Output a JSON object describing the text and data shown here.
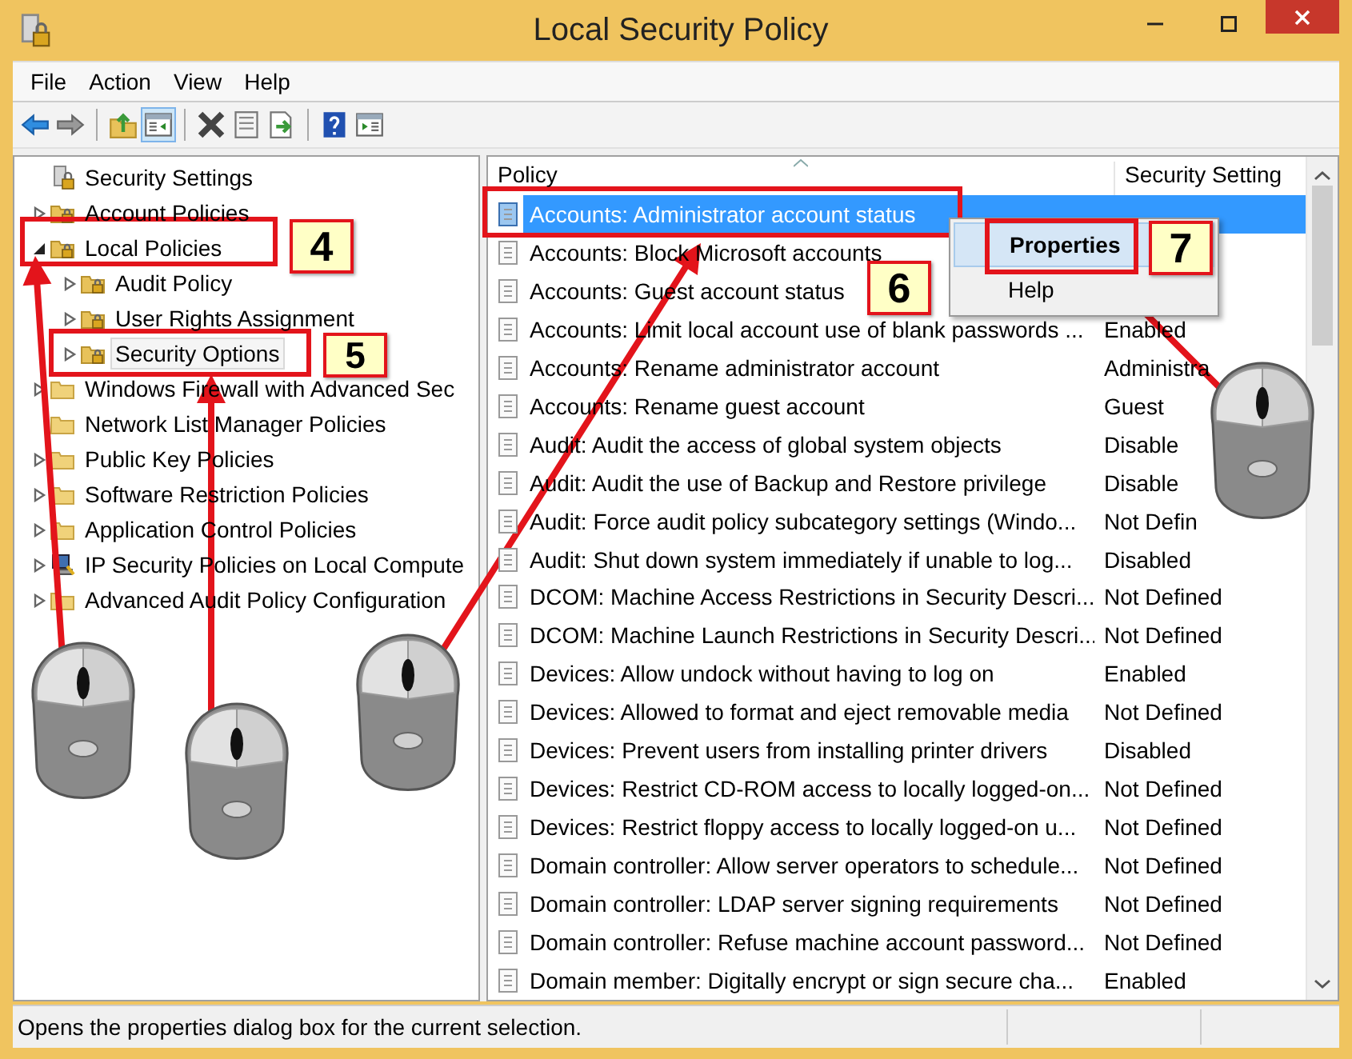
{
  "window": {
    "title": "Local Security Policy"
  },
  "menu": [
    "File",
    "Action",
    "View",
    "Help"
  ],
  "tree": [
    {
      "label": "Security Settings",
      "kind": "root",
      "selected": false,
      "children": [
        {
          "label": "Account Policies",
          "kind": "branch",
          "expanded": false,
          "selected": false
        },
        {
          "label": "Local Policies",
          "kind": "branch",
          "expanded": true,
          "selected": false,
          "children": [
            {
              "label": "Audit Policy",
              "kind": "branch",
              "expanded": false,
              "selected": false
            },
            {
              "label": "User Rights Assignment",
              "kind": "branch",
              "expanded": false,
              "selected": false
            },
            {
              "label": "Security Options",
              "kind": "branch",
              "expanded": false,
              "selected": true
            }
          ]
        },
        {
          "label": "Windows Firewall with Advanced Sec",
          "kind": "branch",
          "expanded": false,
          "selected": false
        },
        {
          "label": "Network List Manager Policies",
          "kind": "leaf",
          "selected": false
        },
        {
          "label": "Public Key Policies",
          "kind": "branch",
          "expanded": false,
          "selected": false
        },
        {
          "label": "Software Restriction Policies",
          "kind": "branch",
          "expanded": false,
          "selected": false
        },
        {
          "label": "Application Control Policies",
          "kind": "branch",
          "expanded": false,
          "selected": false
        },
        {
          "label": "IP Security Policies on Local Compute",
          "kind": "branch",
          "expanded": false,
          "selected": false
        },
        {
          "label": "Advanced Audit Policy Configuration",
          "kind": "branch",
          "expanded": false,
          "selected": false
        }
      ]
    }
  ],
  "table": {
    "columns": [
      "Policy",
      "Security Setting"
    ],
    "rows": [
      {
        "policy": "Accounts: Administrator account status",
        "selected": true
      },
      {
        "policy": "Accounts: Block Microsoft accounts",
        "selected": false
      },
      {
        "policy": "Accounts: Guest account status",
        "selected": false
      },
      {
        "policy": "Accounts: Limit local account use of blank passwords ...",
        "setting": "Enabled",
        "selected": false
      },
      {
        "policy": "Accounts: Rename administrator account",
        "setting": "Administra",
        "selected": false
      },
      {
        "policy": "Accounts: Rename guest account",
        "setting": "Guest",
        "selected": false
      },
      {
        "policy": "Audit: Audit the access of global system objects",
        "setting": "Disable",
        "selected": false
      },
      {
        "policy": "Audit: Audit the use of Backup and Restore privilege",
        "setting": "Disable",
        "selected": false
      },
      {
        "policy": "Audit: Force audit policy subcategory settings (Windo...",
        "setting": "Not Defin",
        "selected": false
      },
      {
        "policy": "Audit: Shut down system immediately if unable to log...",
        "setting": "Disabled",
        "selected": false
      },
      {
        "policy": "DCOM: Machine Access Restrictions in Security Descri...",
        "setting": "Not Defined",
        "selected": false
      },
      {
        "policy": "DCOM: Machine Launch Restrictions in Security Descri...",
        "setting": "Not Defined",
        "selected": false
      },
      {
        "policy": "Devices: Allow undock without having to log on",
        "setting": "Enabled",
        "selected": false
      },
      {
        "policy": "Devices: Allowed to format and eject removable media",
        "setting": "Not Defined",
        "selected": false
      },
      {
        "policy": "Devices: Prevent users from installing printer drivers",
        "setting": "Disabled",
        "selected": false
      },
      {
        "policy": "Devices: Restrict CD-ROM access to locally logged-on...",
        "setting": "Not Defined",
        "selected": false
      },
      {
        "policy": "Devices: Restrict floppy access to locally logged-on u...",
        "setting": "Not Defined",
        "selected": false
      },
      {
        "policy": "Domain controller: Allow server operators to schedule...",
        "setting": "Not Defined",
        "selected": false
      },
      {
        "policy": "Domain controller: LDAP server signing requirements",
        "setting": "Not Defined",
        "selected": false
      },
      {
        "policy": "Domain controller: Refuse machine account password...",
        "setting": "Not Defined",
        "selected": false
      },
      {
        "policy": "Domain member: Digitally encrypt or sign secure cha...",
        "setting": "Enabled",
        "selected": false
      }
    ]
  },
  "context_menu": [
    {
      "label": "Properties",
      "selected": true
    },
    {
      "label": "Help",
      "selected": false
    }
  ],
  "annotations": [
    {
      "number": "4"
    },
    {
      "number": "5"
    },
    {
      "number": "6"
    },
    {
      "number": "7"
    }
  ],
  "status_bar": "Opens the properties dialog box for the current selection."
}
